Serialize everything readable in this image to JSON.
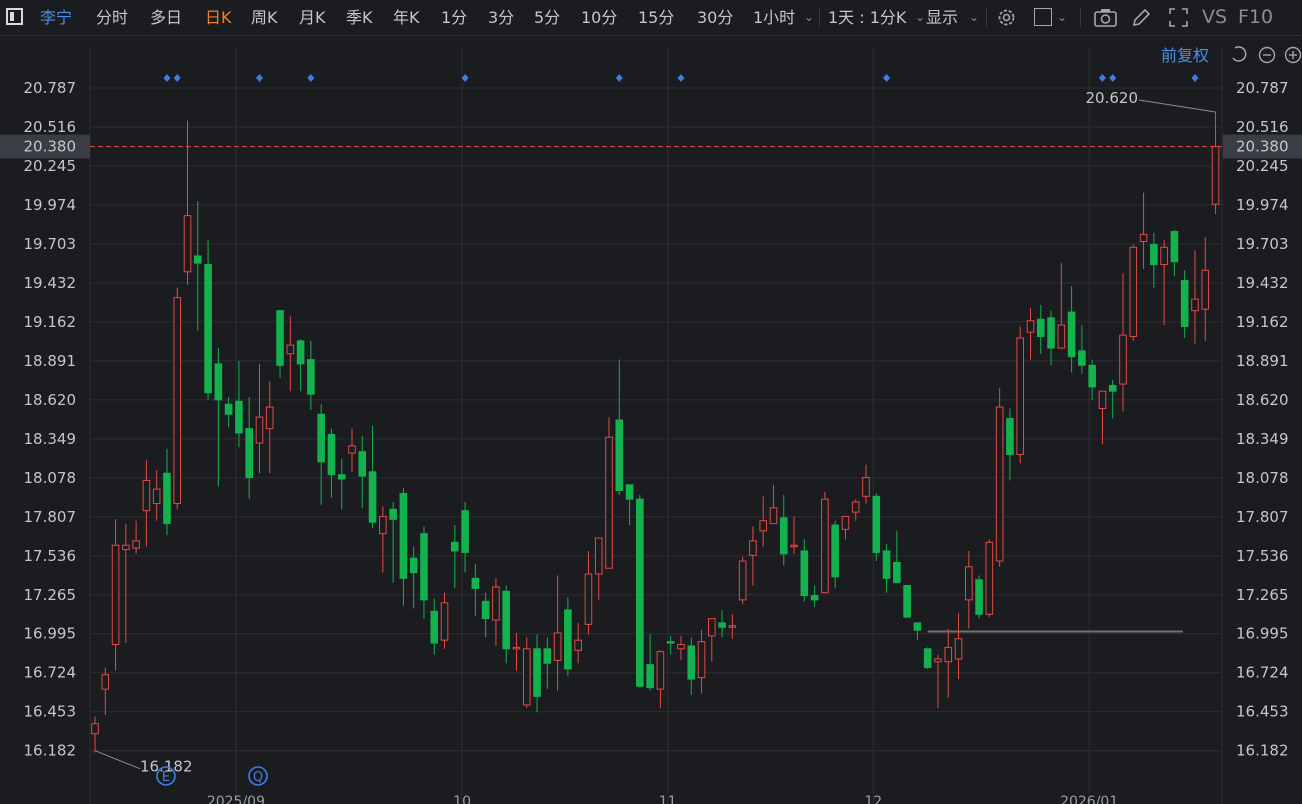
{
  "toolbar": {
    "stock_name": "李宁",
    "periods": [
      "分时",
      "多日",
      "日K",
      "周K",
      "月K",
      "季K",
      "年K",
      "1分",
      "3分",
      "5分",
      "10分",
      "15分",
      "30分",
      "1小时"
    ],
    "active_period": "日K",
    "multi_day": "1天 : 1分K",
    "display": "显示",
    "vs": "VS",
    "f10": "F10",
    "adjust": "前复权"
  },
  "colors": {
    "up": "#e24a43",
    "down": "#13b24e",
    "bg": "#1b1c20",
    "grid": "#2c2e33",
    "marker": "#3d7fe0"
  },
  "chart_data": {
    "type": "candlestick",
    "y_ticks": [
      20.787,
      20.516,
      20.245,
      19.974,
      19.703,
      19.432,
      19.162,
      18.891,
      18.62,
      18.349,
      18.078,
      17.807,
      17.536,
      17.265,
      16.995,
      16.724,
      16.453,
      16.182
    ],
    "x_labels": [
      "2025/09",
      "10",
      "11",
      "12",
      "2026/01"
    ],
    "current_price": "20.380",
    "high_label": "20.620",
    "low_label": "16.182",
    "event_markers": [
      "E",
      "Q"
    ],
    "support_line": 17.01,
    "candles": [
      [
        16.3,
        16.37,
        16.42,
        16.17
      ],
      [
        16.61,
        16.71,
        16.76,
        16.43
      ],
      [
        16.92,
        17.61,
        17.79,
        16.74
      ],
      [
        17.58,
        17.61,
        17.76,
        16.93
      ],
      [
        17.59,
        17.64,
        17.78,
        17.55
      ],
      [
        17.85,
        18.06,
        18.2,
        17.6
      ],
      [
        17.9,
        18.0,
        18.13,
        17.78
      ],
      [
        18.11,
        17.76,
        18.28,
        17.68
      ],
      [
        17.9,
        19.33,
        19.4,
        17.86
      ],
      [
        19.51,
        19.9,
        20.56,
        19.42
      ],
      [
        19.62,
        19.57,
        20.0,
        19.1
      ],
      [
        19.56,
        18.67,
        19.73,
        18.62
      ],
      [
        18.87,
        18.62,
        18.98,
        18.02
      ],
      [
        18.59,
        18.52,
        18.64,
        18.43
      ],
      [
        18.61,
        18.39,
        18.89,
        18.29
      ],
      [
        18.42,
        18.08,
        18.64,
        17.93
      ],
      [
        18.32,
        18.5,
        18.87,
        18.11
      ],
      [
        18.42,
        18.57,
        18.75,
        18.11
      ],
      [
        19.24,
        18.86,
        19.24,
        18.77
      ],
      [
        18.94,
        19.0,
        19.2,
        18.68
      ],
      [
        19.03,
        18.87,
        19.04,
        18.68
      ],
      [
        18.9,
        18.66,
        19.03,
        18.55
      ],
      [
        18.52,
        18.19,
        18.59,
        17.89
      ],
      [
        18.38,
        18.1,
        18.42,
        17.94
      ],
      [
        18.1,
        18.07,
        18.21,
        17.86
      ],
      [
        18.25,
        18.3,
        18.42,
        18.12
      ],
      [
        18.26,
        18.09,
        18.37,
        17.87
      ],
      [
        18.12,
        17.77,
        18.44,
        17.73
      ],
      [
        17.69,
        17.81,
        17.88,
        17.42
      ],
      [
        17.86,
        17.79,
        17.91,
        17.35
      ],
      [
        17.97,
        17.38,
        18.01,
        17.19
      ],
      [
        17.52,
        17.42,
        17.6,
        17.17
      ],
      [
        17.69,
        17.23,
        17.74,
        17.1
      ],
      [
        17.15,
        16.93,
        17.24,
        16.85
      ],
      [
        16.95,
        17.21,
        17.28,
        16.89
      ],
      [
        17.63,
        17.57,
        17.75,
        17.31
      ],
      [
        17.85,
        17.56,
        17.91,
        17.42
      ],
      [
        17.38,
        17.31,
        17.48,
        17.12
      ],
      [
        17.22,
        17.1,
        17.28,
        16.97
      ],
      [
        17.09,
        17.32,
        17.38,
        16.91
      ],
      [
        17.29,
        16.89,
        17.33,
        16.79
      ],
      [
        16.89,
        16.9,
        17.0,
        16.74
      ],
      [
        16.5,
        16.89,
        16.97,
        16.48
      ],
      [
        16.89,
        16.56,
        16.99,
        16.45
      ],
      [
        16.89,
        16.79,
        16.97,
        16.61
      ],
      [
        16.81,
        17.0,
        17.4,
        16.6
      ],
      [
        17.16,
        16.75,
        17.25,
        16.7
      ],
      [
        16.88,
        16.95,
        17.07,
        16.79
      ],
      [
        17.06,
        17.41,
        17.57,
        16.99
      ],
      [
        17.41,
        17.66,
        17.66,
        17.23
      ],
      [
        17.45,
        18.36,
        18.5,
        17.46
      ],
      [
        18.48,
        17.99,
        18.9,
        17.96
      ],
      [
        18.03,
        17.93,
        18.03,
        17.75
      ],
      [
        17.93,
        16.63,
        17.96,
        16.62
      ],
      [
        16.78,
        16.62,
        16.99,
        16.6
      ],
      [
        16.61,
        16.87,
        16.88,
        16.48
      ],
      [
        16.94,
        16.93,
        16.98,
        16.85
      ],
      [
        16.89,
        16.92,
        16.98,
        16.81
      ],
      [
        16.91,
        16.68,
        16.97,
        16.57
      ],
      [
        16.69,
        16.94,
        17.02,
        16.58
      ],
      [
        16.98,
        17.1,
        17.1,
        16.8
      ],
      [
        17.07,
        17.04,
        17.16,
        16.97
      ],
      [
        17.05,
        17.05,
        17.13,
        16.96
      ],
      [
        17.23,
        17.5,
        17.53,
        17.2
      ],
      [
        17.54,
        17.64,
        17.74,
        17.33
      ],
      [
        17.71,
        17.78,
        17.95,
        17.6
      ],
      [
        17.76,
        17.87,
        18.03,
        17.76
      ],
      [
        17.8,
        17.55,
        17.96,
        17.47
      ],
      [
        17.61,
        17.61,
        17.81,
        17.55
      ],
      [
        17.57,
        17.26,
        17.65,
        17.22
      ],
      [
        17.26,
        17.23,
        17.33,
        17.18
      ],
      [
        17.28,
        17.93,
        17.98,
        17.34
      ],
      [
        17.75,
        17.39,
        17.78,
        17.31
      ],
      [
        17.72,
        17.81,
        17.81,
        17.65
      ],
      [
        17.84,
        17.91,
        17.93,
        17.78
      ],
      [
        17.95,
        18.08,
        18.17,
        17.9
      ],
      [
        17.95,
        17.56,
        17.97,
        17.5
      ],
      [
        17.57,
        17.38,
        17.62,
        17.28
      ],
      [
        17.49,
        17.35,
        17.71,
        17.35
      ],
      [
        17.33,
        17.11,
        17.33,
        17.2
      ],
      [
        17.07,
        17.02,
        17.07,
        16.95
      ],
      [
        16.89,
        16.76,
        16.9,
        16.75
      ],
      [
        16.8,
        16.82,
        16.85,
        16.48
      ],
      [
        16.8,
        16.9,
        17.03,
        16.55
      ],
      [
        16.82,
        16.96,
        17.14,
        16.68
      ],
      [
        17.23,
        17.46,
        17.57,
        17.03
      ],
      [
        17.37,
        17.13,
        17.4,
        17.1
      ],
      [
        17.13,
        17.63,
        17.65,
        17.11
      ],
      [
        17.5,
        18.57,
        18.7,
        17.46
      ],
      [
        18.49,
        18.24,
        18.56,
        18.06
      ],
      [
        18.24,
        19.05,
        19.13,
        18.18
      ],
      [
        19.09,
        19.17,
        19.26,
        18.9
      ],
      [
        19.18,
        19.06,
        19.28,
        18.94
      ],
      [
        19.19,
        18.98,
        19.24,
        18.86
      ],
      [
        18.98,
        19.14,
        19.57,
        18.98
      ],
      [
        19.23,
        18.92,
        19.41,
        18.81
      ],
      [
        18.96,
        18.86,
        19.14,
        18.8
      ],
      [
        18.86,
        18.71,
        18.9,
        18.62
      ],
      [
        18.56,
        18.68,
        18.68,
        18.31
      ],
      [
        18.72,
        18.68,
        18.76,
        18.49
      ],
      [
        18.73,
        19.07,
        19.5,
        18.54
      ],
      [
        19.06,
        19.68,
        19.7,
        19.03
      ],
      [
        19.72,
        19.77,
        20.06,
        19.53
      ],
      [
        19.7,
        19.56,
        19.78,
        19.4
      ],
      [
        19.56,
        19.68,
        19.73,
        19.14
      ],
      [
        19.79,
        19.58,
        19.8,
        19.48
      ],
      [
        19.45,
        19.13,
        19.52,
        19.05
      ],
      [
        19.24,
        19.32,
        19.66,
        19.01
      ],
      [
        19.25,
        19.52,
        19.75,
        19.03
      ],
      [
        19.98,
        20.38,
        20.62,
        19.91
      ]
    ]
  }
}
